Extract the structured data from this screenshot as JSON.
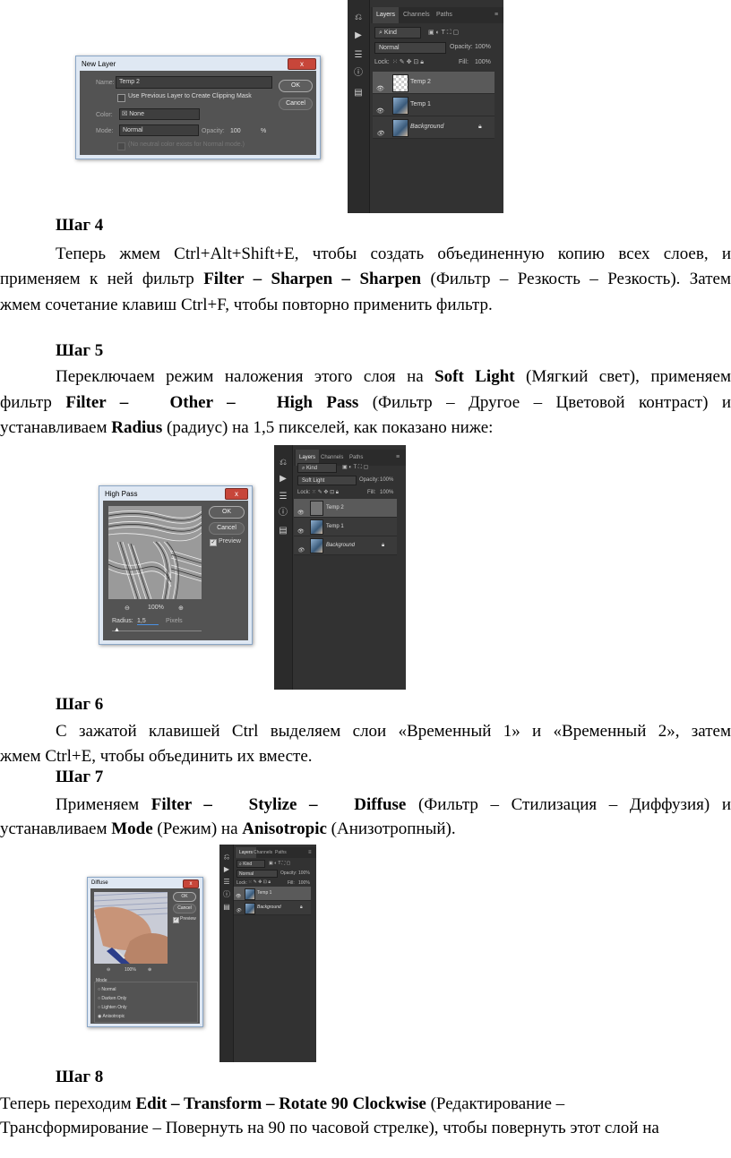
{
  "ps_panel": {
    "tabs": [
      "Layers",
      "Channels",
      "Paths"
    ],
    "kind_label": "Kind",
    "opacity_label": "Opacity:",
    "opacity_value": "100%",
    "lock_label": "Lock:",
    "fill_label": "Fill:",
    "fill_value": "100%"
  },
  "screenshot1": {
    "blend_mode": "Normal",
    "layers": [
      "Temp 2",
      "Temp 1",
      "Background"
    ],
    "dialog": {
      "title": "New Layer",
      "close_label": "x",
      "name_label": "Name:",
      "name_value": "Temp 2",
      "clipping_mask_label": "Use Previous Layer to Create Clipping Mask",
      "color_label": "Color:",
      "color_value": "None",
      "mode_label": "Mode:",
      "mode_value": "Normal",
      "opacity_label": "Opacity:",
      "opacity_value": "100",
      "opacity_unit": "%",
      "neutral_label": "(No neutral color exists for Normal mode.)",
      "ok_label": "OK",
      "cancel_label": "Cancel"
    }
  },
  "step4": {
    "heading": "Шаг 4",
    "line1": "Теперь жмем Ctrl+Alt+Shift+E, чтобы создать объединенную копию всех слоев, и",
    "line2_pre": "применяем к ней фильтр ",
    "line2_bold": "Filter – Sharpen – Sharpen",
    "line2_post": " (Фильтр – Резкость – Резкость). Затем",
    "line3": "жмем сочетание клавиш Ctrl+F, чтобы повторно применить фильтр."
  },
  "step5": {
    "heading": "Шаг 5",
    "line1_pre": "Переключаем режим наложения этого слоя на ",
    "line1_bold": "Soft Light",
    "line1_post": " (Мягкий свет), применяем",
    "line2_pre": "фильтр ",
    "line2_bold": "Filter –   Other –   High Pass",
    "line2_post": " (Фильтр – Другое – Цветовой контраст) и",
    "line3_pre": "устанавливаем ",
    "line3_bold": "Radius",
    "line3_post": " (радиус) на 1,5 пикселей, как показано ниже:"
  },
  "screenshot2": {
    "blend_mode": "Soft Light",
    "layers": [
      "Temp 2",
      "Temp 1",
      "Background"
    ],
    "dialog": {
      "title": "High Pass",
      "close_label": "x",
      "ok_label": "OK",
      "cancel_label": "Cancel",
      "preview_label": "Preview",
      "zoom": "100%",
      "radius_label": "Radius:",
      "radius_value": "1,5",
      "radius_unit": "Pixels"
    }
  },
  "step6": {
    "heading": "Шаг 6",
    "line1": "С зажатой клавишей Ctrl выделяем слои «Временный 1» и «Временный 2», затем",
    "line2": "жмем Ctrl+E, чтобы объединить их вместе."
  },
  "step7": {
    "heading": "Шаг 7",
    "line1_pre": "Применяем ",
    "line1_bold": "Filter –   Stylize –   Diffuse",
    "line1_post": " (Фильтр – Стилизация – Диффузия) и",
    "line2_pre": "устанавливаем ",
    "line2_bold1": "Mode",
    "line2_mid": " (Режим) на ",
    "line2_bold2": "Anisotropic",
    "line2_post": " (Анизотропный)."
  },
  "screenshot3": {
    "blend_mode": "Normal",
    "layers": [
      "Temp 1",
      "Background"
    ],
    "dialog": {
      "title": "Diffuse",
      "close_label": "x",
      "ok_label": "OK",
      "cancel_label": "Cancel",
      "preview_label": "Preview",
      "zoom": "100%",
      "mode_group": "Mode",
      "modes": [
        "Normal",
        "Darken Only",
        "Lighten Only",
        "Anisotropic"
      ],
      "selected_mode": "Anisotropic"
    }
  },
  "step8": {
    "heading": "Шаг 8",
    "line1_pre": "Теперь переходим ",
    "line1_bold": "Edit – Transform – Rotate 90 Clockwise",
    "line1_post": " (Редактирование –",
    "line2": "Трансформирование – Повернуть на 90 по часовой стрелке), чтобы повернуть этот слой на"
  }
}
